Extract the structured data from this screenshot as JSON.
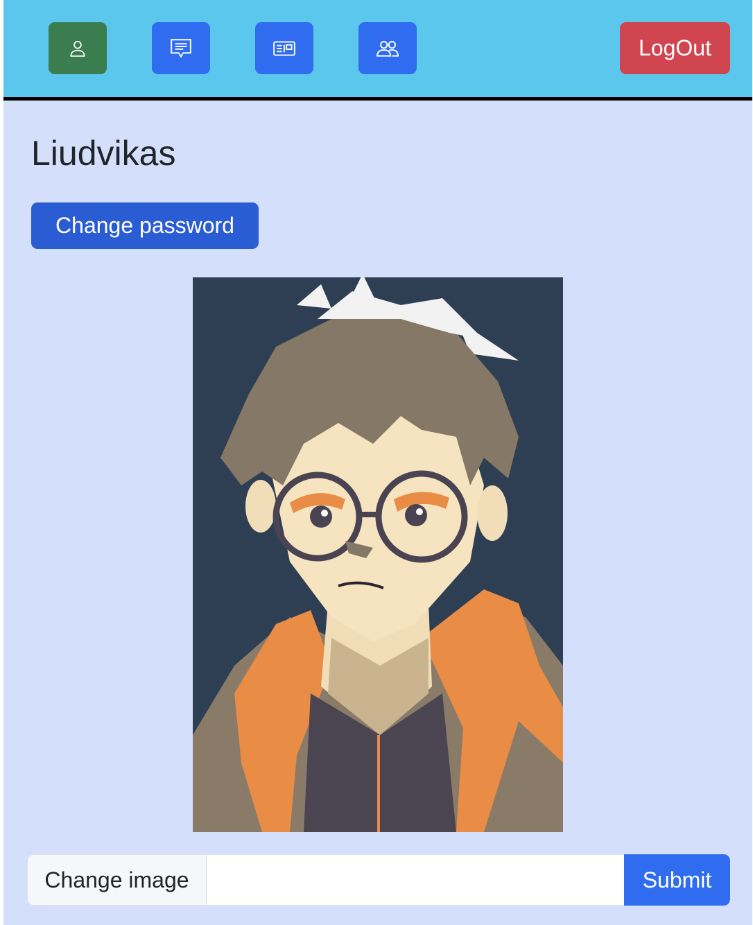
{
  "navbar": {
    "items": [
      {
        "icon": "person-icon",
        "name": "profile",
        "color": "#3a7d4f"
      },
      {
        "icon": "chat-icon",
        "name": "messages",
        "color": "#2f6cf0"
      },
      {
        "icon": "newspaper-icon",
        "name": "posts",
        "color": "#2f6cf0"
      },
      {
        "icon": "people-icon",
        "name": "friends",
        "color": "#2f6cf0"
      }
    ],
    "logout_label": "LogOut",
    "background": "#5cc7ec"
  },
  "profile": {
    "username": "Liudvikas",
    "change_password_label": "Change password",
    "avatar_alt": "Anime boy with glasses and orange hoodie"
  },
  "upload": {
    "label": "Change image",
    "value": "",
    "submit_label": "Submit"
  },
  "colors": {
    "page_background": "#d4e0fb",
    "primary": "#2f6cf0",
    "danger": "#d0454f",
    "success": "#3a7d4f"
  }
}
